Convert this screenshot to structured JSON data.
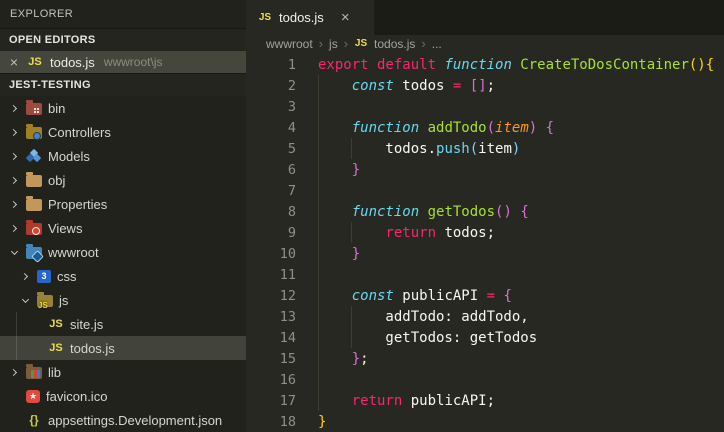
{
  "colors": {
    "editor_bg": "#272822",
    "sidebar_bg": "#21221b",
    "tabbar_bg": "#1b1c16",
    "selection_bg": "#45463c",
    "keyword_pink": "#f92672",
    "keyword_cyan_italic": "#66d9ef",
    "function_green": "#a6e22e",
    "param_orange_italic": "#fd971f",
    "text_white": "#f8f8f2",
    "bracket_gold": "#ffd700",
    "bracket_orchid": "#da70d6",
    "bracket_blue": "#87cefa",
    "js_icon_yellow": "#f0dc4e",
    "line_number": "#90908a"
  },
  "icons": {
    "js": "JS",
    "json": "{}",
    "star": "★",
    "css": "3"
  },
  "sidebar": {
    "title": "EXPLORER",
    "open_editors": {
      "label": "OPEN EDITORS",
      "item": {
        "close": "×",
        "file": "todos.js",
        "path": "wwwroot\\js"
      }
    },
    "project_section": {
      "label": "JEST-TESTING"
    },
    "tree": [
      {
        "label": "bin",
        "icon": "bin",
        "level": 0,
        "expanded": false
      },
      {
        "label": "Controllers",
        "icon": "controllers",
        "level": 0,
        "expanded": false
      },
      {
        "label": "Models",
        "icon": "models",
        "level": 0,
        "expanded": false
      },
      {
        "label": "obj",
        "icon": "plain",
        "level": 0,
        "expanded": false
      },
      {
        "label": "Properties",
        "icon": "plain",
        "level": 0,
        "expanded": false
      },
      {
        "label": "Views",
        "icon": "views",
        "level": 0,
        "expanded": false
      },
      {
        "label": "wwwroot",
        "icon": "wwwroot",
        "level": 0,
        "expanded": true
      },
      {
        "label": "css",
        "icon": "css",
        "level": 1,
        "expanded": false
      },
      {
        "label": "js",
        "icon": "jsfolder",
        "level": 1,
        "expanded": true
      },
      {
        "label": "site.js",
        "icon": "jsfile",
        "level": 2,
        "file": true
      },
      {
        "label": "todos.js",
        "icon": "jsfile",
        "level": 2,
        "file": true,
        "selected": true
      },
      {
        "label": "lib",
        "icon": "lib",
        "level": 0,
        "expanded": false
      },
      {
        "label": "favicon.ico",
        "icon": "favicon",
        "level": 0,
        "file": true
      },
      {
        "label": "appsettings.Development.json",
        "icon": "json",
        "level": 0,
        "file": true
      }
    ]
  },
  "tab": {
    "label": "todos.js",
    "close": "×"
  },
  "breadcrumb": {
    "separator": "›",
    "items": [
      {
        "label": "wwwroot"
      },
      {
        "label": "js"
      },
      {
        "label": "todos.js",
        "icon": "jsfile"
      },
      {
        "label": "..."
      }
    ]
  },
  "editor": {
    "lines": [
      {
        "n": "1",
        "g": [],
        "t": [
          [
            "export default ",
            "k"
          ],
          [
            "function ",
            "ti"
          ],
          [
            "CreateToDosContainer",
            "fn"
          ],
          [
            "(){",
            "b1"
          ]
        ]
      },
      {
        "n": "2",
        "g": [
          0
        ],
        "t": [
          [
            "    ",
            "w"
          ],
          [
            "const",
            "ti"
          ],
          [
            " todos ",
            "w"
          ],
          [
            "=",
            "k"
          ],
          [
            " ",
            "w"
          ],
          [
            "[]",
            "b2"
          ],
          [
            ";",
            "w"
          ]
        ]
      },
      {
        "n": "3",
        "g": [
          0
        ],
        "t": []
      },
      {
        "n": "4",
        "g": [
          0
        ],
        "t": [
          [
            "    ",
            "w"
          ],
          [
            "function",
            "ti"
          ],
          [
            " ",
            "w"
          ],
          [
            "addTodo",
            "fn"
          ],
          [
            "(",
            "b2"
          ],
          [
            "item",
            "pi"
          ],
          [
            ")",
            "b2"
          ],
          [
            " ",
            "w"
          ],
          [
            "{",
            "b2"
          ]
        ]
      },
      {
        "n": "5",
        "g": [
          0,
          4
        ],
        "t": [
          [
            "        todos.",
            "w"
          ],
          [
            "push",
            "cy"
          ],
          [
            "(",
            "b3"
          ],
          [
            "item",
            "w"
          ],
          [
            ")",
            "b3"
          ]
        ]
      },
      {
        "n": "6",
        "g": [
          0
        ],
        "t": [
          [
            "    ",
            "w"
          ],
          [
            "}",
            "b2"
          ]
        ]
      },
      {
        "n": "7",
        "g": [
          0
        ],
        "t": []
      },
      {
        "n": "8",
        "g": [
          0
        ],
        "t": [
          [
            "    ",
            "w"
          ],
          [
            "function",
            "ti"
          ],
          [
            " ",
            "w"
          ],
          [
            "getTodos",
            "fn"
          ],
          [
            "()",
            "b2"
          ],
          [
            " ",
            "w"
          ],
          [
            "{",
            "b2"
          ]
        ]
      },
      {
        "n": "9",
        "g": [
          0,
          4
        ],
        "t": [
          [
            "        ",
            "w"
          ],
          [
            "return",
            "k"
          ],
          [
            " todos;",
            "w"
          ]
        ]
      },
      {
        "n": "10",
        "g": [
          0
        ],
        "t": [
          [
            "    ",
            "w"
          ],
          [
            "}",
            "b2"
          ]
        ]
      },
      {
        "n": "11",
        "g": [
          0
        ],
        "t": []
      },
      {
        "n": "12",
        "g": [
          0
        ],
        "t": [
          [
            "    ",
            "w"
          ],
          [
            "const",
            "ti"
          ],
          [
            " publicAPI ",
            "w"
          ],
          [
            "=",
            "k"
          ],
          [
            " ",
            "w"
          ],
          [
            "{",
            "b2"
          ]
        ]
      },
      {
        "n": "13",
        "g": [
          0,
          4
        ],
        "t": [
          [
            "        addTodo: addTodo,",
            "w"
          ]
        ]
      },
      {
        "n": "14",
        "g": [
          0,
          4
        ],
        "t": [
          [
            "        getTodos: getTodos",
            "w"
          ]
        ]
      },
      {
        "n": "15",
        "g": [
          0
        ],
        "t": [
          [
            "    ",
            "w"
          ],
          [
            "}",
            "b2"
          ],
          [
            ";",
            "w"
          ]
        ]
      },
      {
        "n": "16",
        "g": [
          0
        ],
        "t": []
      },
      {
        "n": "17",
        "g": [
          0
        ],
        "t": [
          [
            "    ",
            "w"
          ],
          [
            "return",
            "k"
          ],
          [
            " publicAPI;",
            "w"
          ]
        ]
      },
      {
        "n": "18",
        "g": [],
        "t": [
          [
            "}",
            "b1"
          ]
        ]
      }
    ]
  }
}
